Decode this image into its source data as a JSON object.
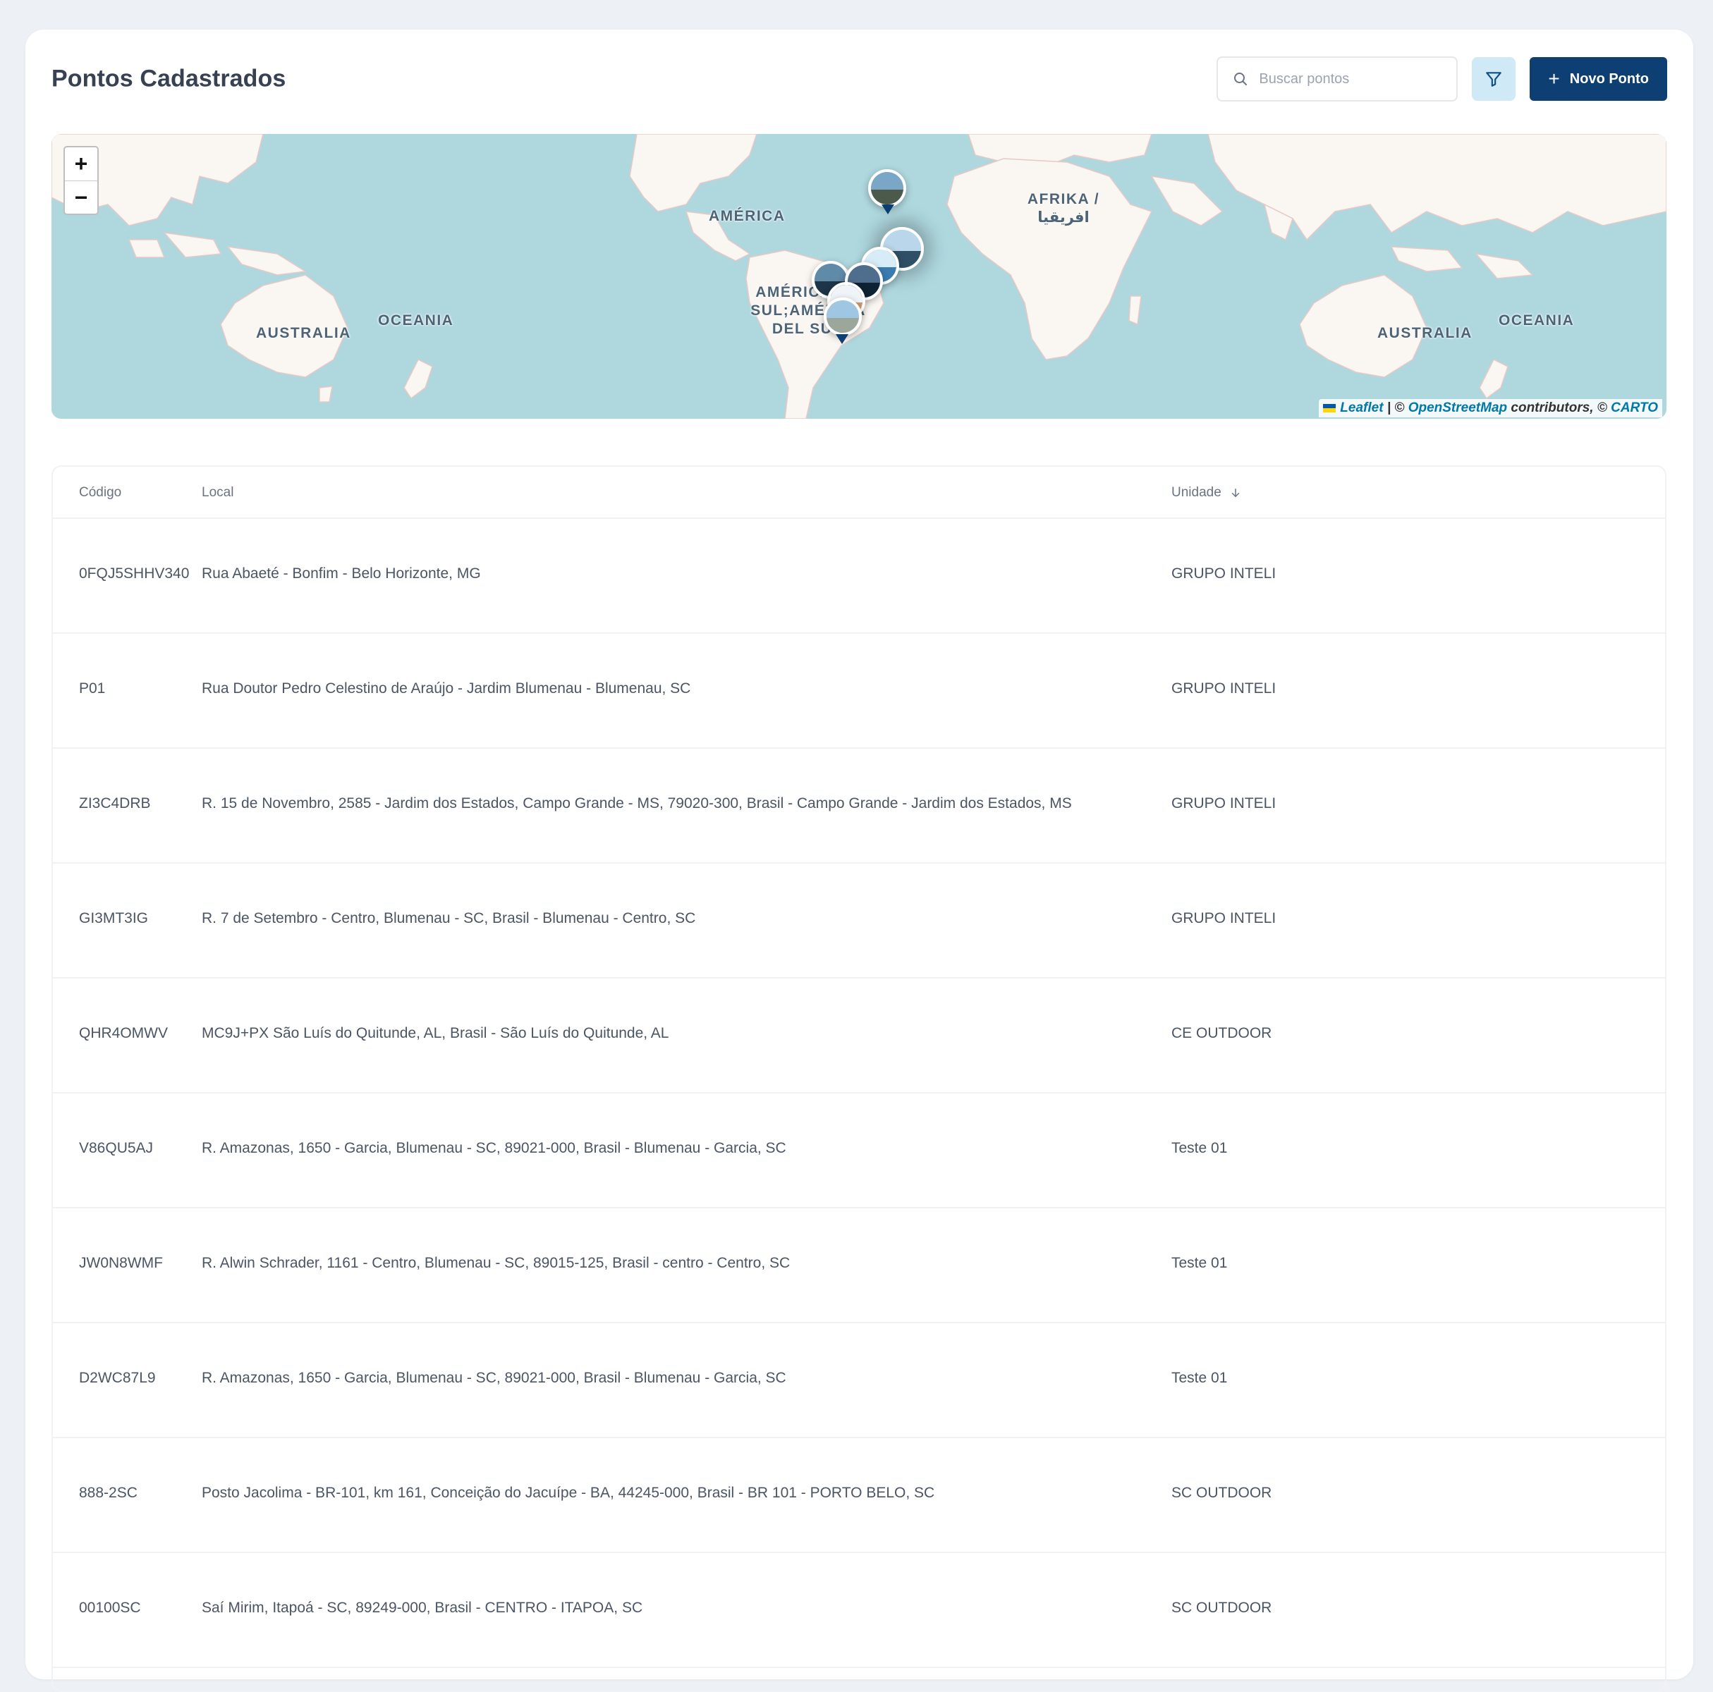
{
  "page": {
    "title": "Pontos Cadastrados"
  },
  "toolbar": {
    "search_placeholder": "Buscar pontos",
    "new_point_label": "Novo Ponto"
  },
  "map": {
    "zoom_in": "+",
    "zoom_out": "−",
    "labels": {
      "australia_left": "AUSTRALIA",
      "oceania_left": "OCEANIA",
      "america": "AMÉRICA",
      "south_america": "AMÉRICA DO SUL;AMÉRICA DEL SUR",
      "africa": "AFRIKA / افريقيا",
      "australia_right": "AUSTRALIA",
      "oceania_right": "OCEANIA"
    },
    "attribution": {
      "leaflet": "Leaflet",
      "sep1": " | © ",
      "osm": "OpenStreetMap",
      "contributors": " contributors, © ",
      "carto": "CARTO"
    },
    "colors": {
      "water": "#aed7de",
      "land": "#faf6f1",
      "pin": "#0d3f72"
    }
  },
  "table": {
    "headers": {
      "code": "Código",
      "location": "Local",
      "unit": "Unidade"
    },
    "rows": [
      {
        "code": "0FQJ5SHHV340",
        "location": "Rua Abaeté - Bonfim - Belo Horizonte, MG",
        "unit": "GRUPO INTELI"
      },
      {
        "code": "P01",
        "location": "Rua Doutor Pedro Celestino de Araújo - Jardim Blumenau - Blumenau, SC",
        "unit": "GRUPO INTELI"
      },
      {
        "code": "ZI3C4DRB",
        "location": "R. 15 de Novembro, 2585 - Jardim dos Estados, Campo Grande - MS, 79020-300, Brasil - Campo Grande - Jardim dos Estados, MS",
        "unit": "GRUPO INTELI"
      },
      {
        "code": "GI3MT3IG",
        "location": "R. 7 de Setembro - Centro, Blumenau - SC, Brasil - Blumenau - Centro, SC",
        "unit": "GRUPO INTELI"
      },
      {
        "code": "QHR4OMWV",
        "location": "MC9J+PX São Luís do Quitunde, AL, Brasil - São Luís do Quitunde, AL",
        "unit": "CE OUTDOOR"
      },
      {
        "code": "V86QU5AJ",
        "location": "R. Amazonas, 1650 - Garcia, Blumenau - SC, 89021-000, Brasil - Blumenau - Garcia, SC",
        "unit": "Teste 01"
      },
      {
        "code": "JW0N8WMF",
        "location": "R. Alwin Schrader, 1161 - Centro, Blumenau - SC, 89015-125, Brasil - centro - Centro, SC",
        "unit": "Teste 01"
      },
      {
        "code": "D2WC87L9",
        "location": "R. Amazonas, 1650 - Garcia, Blumenau - SC, 89021-000, Brasil - Blumenau - Garcia, SC",
        "unit": "Teste 01"
      },
      {
        "code": "888-2SC",
        "location": "Posto Jacolima - BR-101, km 161, Conceição do Jacuípe - BA, 44245-000, Brasil - BR 101 - PORTO BELO, SC",
        "unit": "SC OUTDOOR"
      },
      {
        "code": "00100SC",
        "location": "Saí Mirim, Itapoá - SC, 89249-000, Brasil - CENTRO - ITAPOA, SC",
        "unit": "SC OUTDOOR"
      }
    ]
  }
}
